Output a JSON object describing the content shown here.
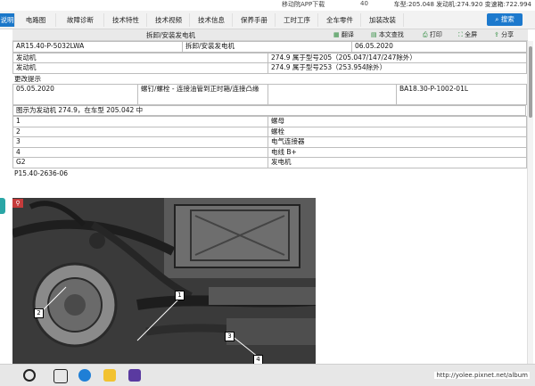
{
  "topbar": {
    "left_text": "移动院APP下载",
    "badge": "40",
    "vehicle_info": "车型:205.048 发动机:274.920 变速箱:722.994"
  },
  "tabs": [
    {
      "label": "说明"
    },
    {
      "label": "电路图"
    },
    {
      "label": "故障诊断"
    },
    {
      "label": "技术特性"
    },
    {
      "label": "技术视频"
    },
    {
      "label": "技术信息"
    },
    {
      "label": "保养手册"
    },
    {
      "label": "工时工序"
    },
    {
      "label": "全车零件"
    },
    {
      "label": "加装改装"
    }
  ],
  "search_button": "搜索",
  "subbar": {
    "title": "拆卸/安装发电机",
    "actions": [
      "翻译",
      "本文查找",
      "打印",
      "全屏",
      "分享"
    ]
  },
  "doc": {
    "code": "AR15.40-P-5032LWA",
    "title": "拆卸/安装发电机",
    "date": "06.05.2020",
    "rows": [
      {
        "label": "发动机",
        "value": "274.9 属于型号205（205.047/147/247除外）"
      },
      {
        "label": "发动机",
        "value": "274.9 属于型号253（253.954除外）"
      }
    ],
    "change_notice": "更改提示",
    "change": {
      "date": "05.05.2020",
      "desc": "螺钉/螺栓 - 连接油管到正时箱/连接凸缘",
      "ref": "BA18.30-P-1002-01L"
    },
    "figure_caption": "图示为发动机 274.9，在车型 205.042 中",
    "parts": [
      {
        "num": "1",
        "name": "螺母"
      },
      {
        "num": "2",
        "name": "螺栓"
      },
      {
        "num": "3",
        "name": "电气连接器"
      },
      {
        "num": "4",
        "name": "电线 B+"
      },
      {
        "num": "G2",
        "name": "发电机"
      }
    ],
    "image_ref": "P15.40-2636-06"
  },
  "image_callouts": [
    "1",
    "2",
    "3",
    "4"
  ],
  "watermark": "http://yolee.pixnet.net/album",
  "colors": {
    "accent": "#1a77c9",
    "tab_active": "#1a77c9",
    "zoom": "#c53b3b"
  }
}
